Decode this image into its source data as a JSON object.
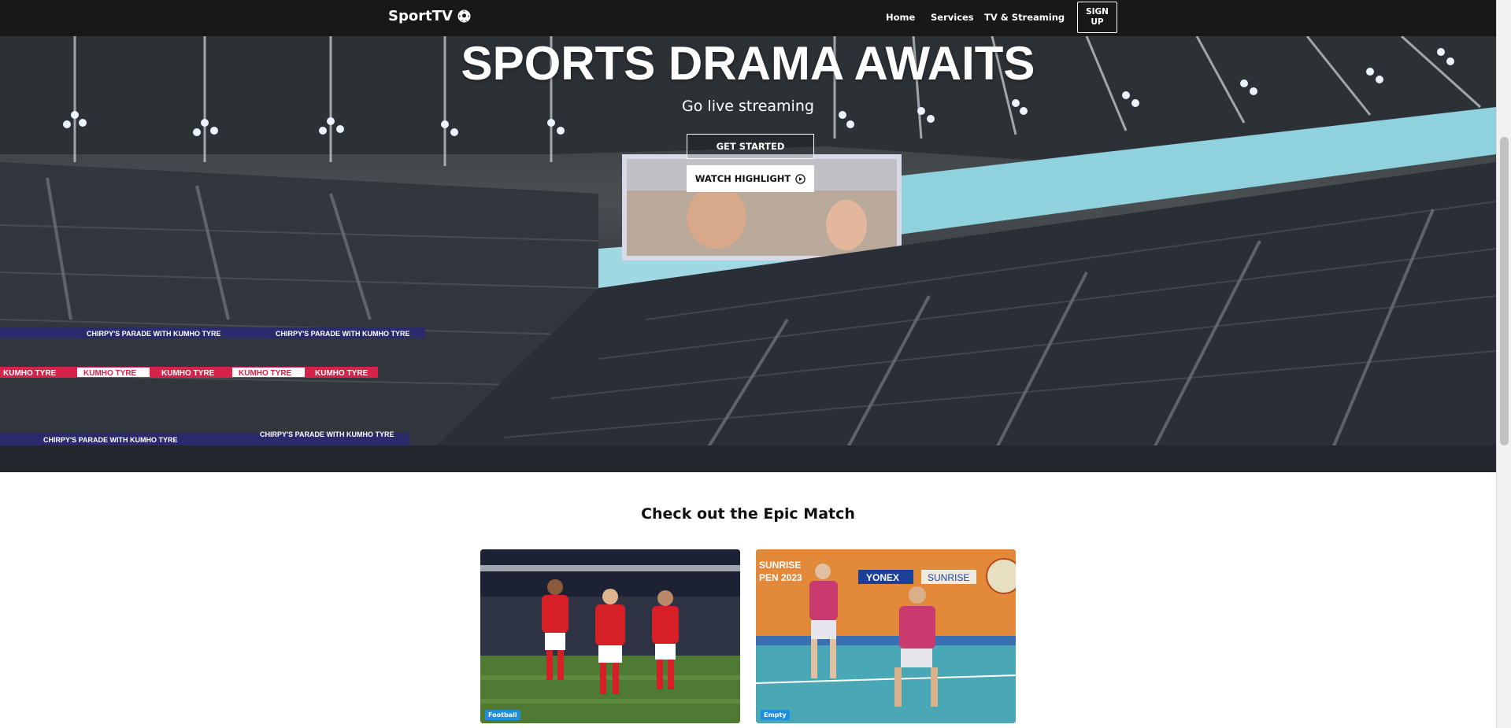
{
  "navbar": {
    "brand": "SportTV",
    "brand_icon": "soccer-ball-icon",
    "links": [
      "Home",
      "Services",
      "TV & Streaming"
    ],
    "signup_label": "SIGN UP"
  },
  "hero": {
    "title": "SPORTS DRAMA AWAITS",
    "subtitle": "Go live streaming",
    "get_started_label": "GET STARTED",
    "watch_label": "WATCH HIGHLIGHT",
    "watch_icon": "play-circle-icon",
    "banner_texts": [
      "CHIRPY'S PARADE WITH KUMHO TYRE",
      "KUMHO TYRE"
    ]
  },
  "section": {
    "title": "Check out the Epic Match",
    "cards": [
      {
        "badge": "Football",
        "image": "football-players-celebrating"
      },
      {
        "badge": "Empty",
        "image": "badminton-doubles-players"
      }
    ]
  },
  "colors": {
    "navbar_bg": "#1a1718",
    "badge_bg": "#1e8fe0",
    "page_bg": "#ffffff"
  }
}
